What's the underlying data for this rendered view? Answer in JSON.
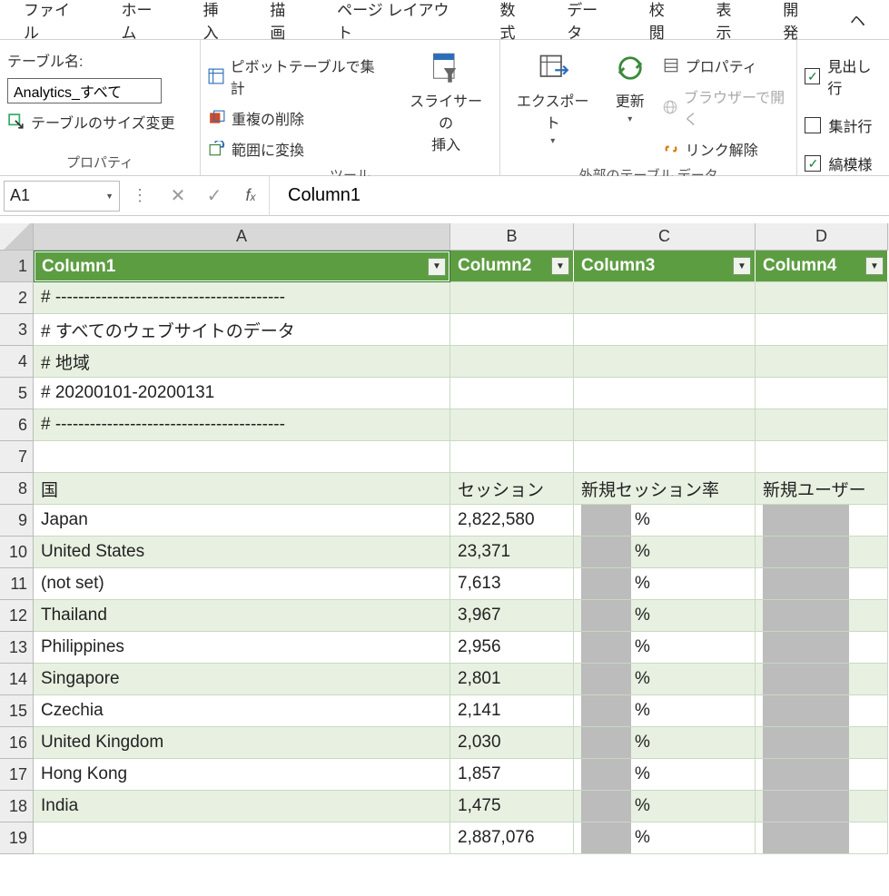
{
  "ribbon": {
    "tabs": [
      "ファイル",
      "ホーム",
      "挿入",
      "描画",
      "ページ レイアウト",
      "数式",
      "データ",
      "校閲",
      "表示",
      "開発",
      "ヘ"
    ],
    "group_table_name_label": "テーブル名:",
    "table_name_value": "Analytics_すべて",
    "resize_table": "テーブルのサイズ変更",
    "group1_label": "プロパティ",
    "pivot_summarize": "ピボットテーブルで集計",
    "remove_duplicates": "重複の削除",
    "convert_range": "範囲に変換",
    "slicer_insert": "スライサーの\n挿入",
    "group2_label": "ツール",
    "export": "エクスポート",
    "refresh": "更新",
    "properties": "プロパティ",
    "open_browser": "ブラウザーで開く",
    "unlink": "リンク解除",
    "group3_label": "外部のテーブル データ",
    "opt_header": "見出し行",
    "opt_total": "集計行",
    "opt_banded": "縞模様"
  },
  "namebox": "A1",
  "formula_value": "Column1",
  "columns": [
    "A",
    "B",
    "C",
    "D"
  ],
  "table_headers": [
    "Column1",
    "Column2",
    "Column3",
    "Column4"
  ],
  "rows": [
    {
      "n": 1,
      "header": true
    },
    {
      "n": 2,
      "a": "# ----------------------------------------",
      "b": "",
      "c": "",
      "d": ""
    },
    {
      "n": 3,
      "a": "# すべてのウェブサイトのデータ",
      "b": "",
      "c": "",
      "d": ""
    },
    {
      "n": 4,
      "a": "# 地域",
      "b": "",
      "c": "",
      "d": ""
    },
    {
      "n": 5,
      "a": "# 20200101-20200131",
      "b": "",
      "c": "",
      "d": ""
    },
    {
      "n": 6,
      "a": "# ----------------------------------------",
      "b": "",
      "c": "",
      "d": ""
    },
    {
      "n": 7,
      "a": "",
      "b": "",
      "c": "",
      "d": ""
    },
    {
      "n": 8,
      "a": "国",
      "b": "セッション",
      "c": "新規セッション率",
      "d": "新規ユーザー"
    },
    {
      "n": 9,
      "a": "Japan",
      "b": "2,822,580",
      "c": "%",
      "d": "",
      "redact": true
    },
    {
      "n": 10,
      "a": "United States",
      "b": "23,371",
      "c": "%",
      "d": "",
      "redact": true
    },
    {
      "n": 11,
      "a": "(not set)",
      "b": "7,613",
      "c": "%",
      "d": "",
      "redact": true
    },
    {
      "n": 12,
      "a": "Thailand",
      "b": "3,967",
      "c": "%",
      "d": "",
      "redact": true
    },
    {
      "n": 13,
      "a": "Philippines",
      "b": "2,956",
      "c": "%",
      "d": "",
      "redact": true
    },
    {
      "n": 14,
      "a": "Singapore",
      "b": "2,801",
      "c": "%",
      "d": "",
      "redact": true
    },
    {
      "n": 15,
      "a": "Czechia",
      "b": "2,141",
      "c": "%",
      "d": "",
      "redact": true
    },
    {
      "n": 16,
      "a": "United Kingdom",
      "b": "2,030",
      "c": "%",
      "d": "",
      "redact": true
    },
    {
      "n": 17,
      "a": "Hong Kong",
      "b": "1,857",
      "c": "%",
      "d": "",
      "redact": true
    },
    {
      "n": 18,
      "a": "India",
      "b": "1,475",
      "c": "%",
      "d": "",
      "redact": true
    },
    {
      "n": 19,
      "a": "",
      "b": "2,887,076",
      "c": "%",
      "d": "",
      "redact": true
    }
  ]
}
